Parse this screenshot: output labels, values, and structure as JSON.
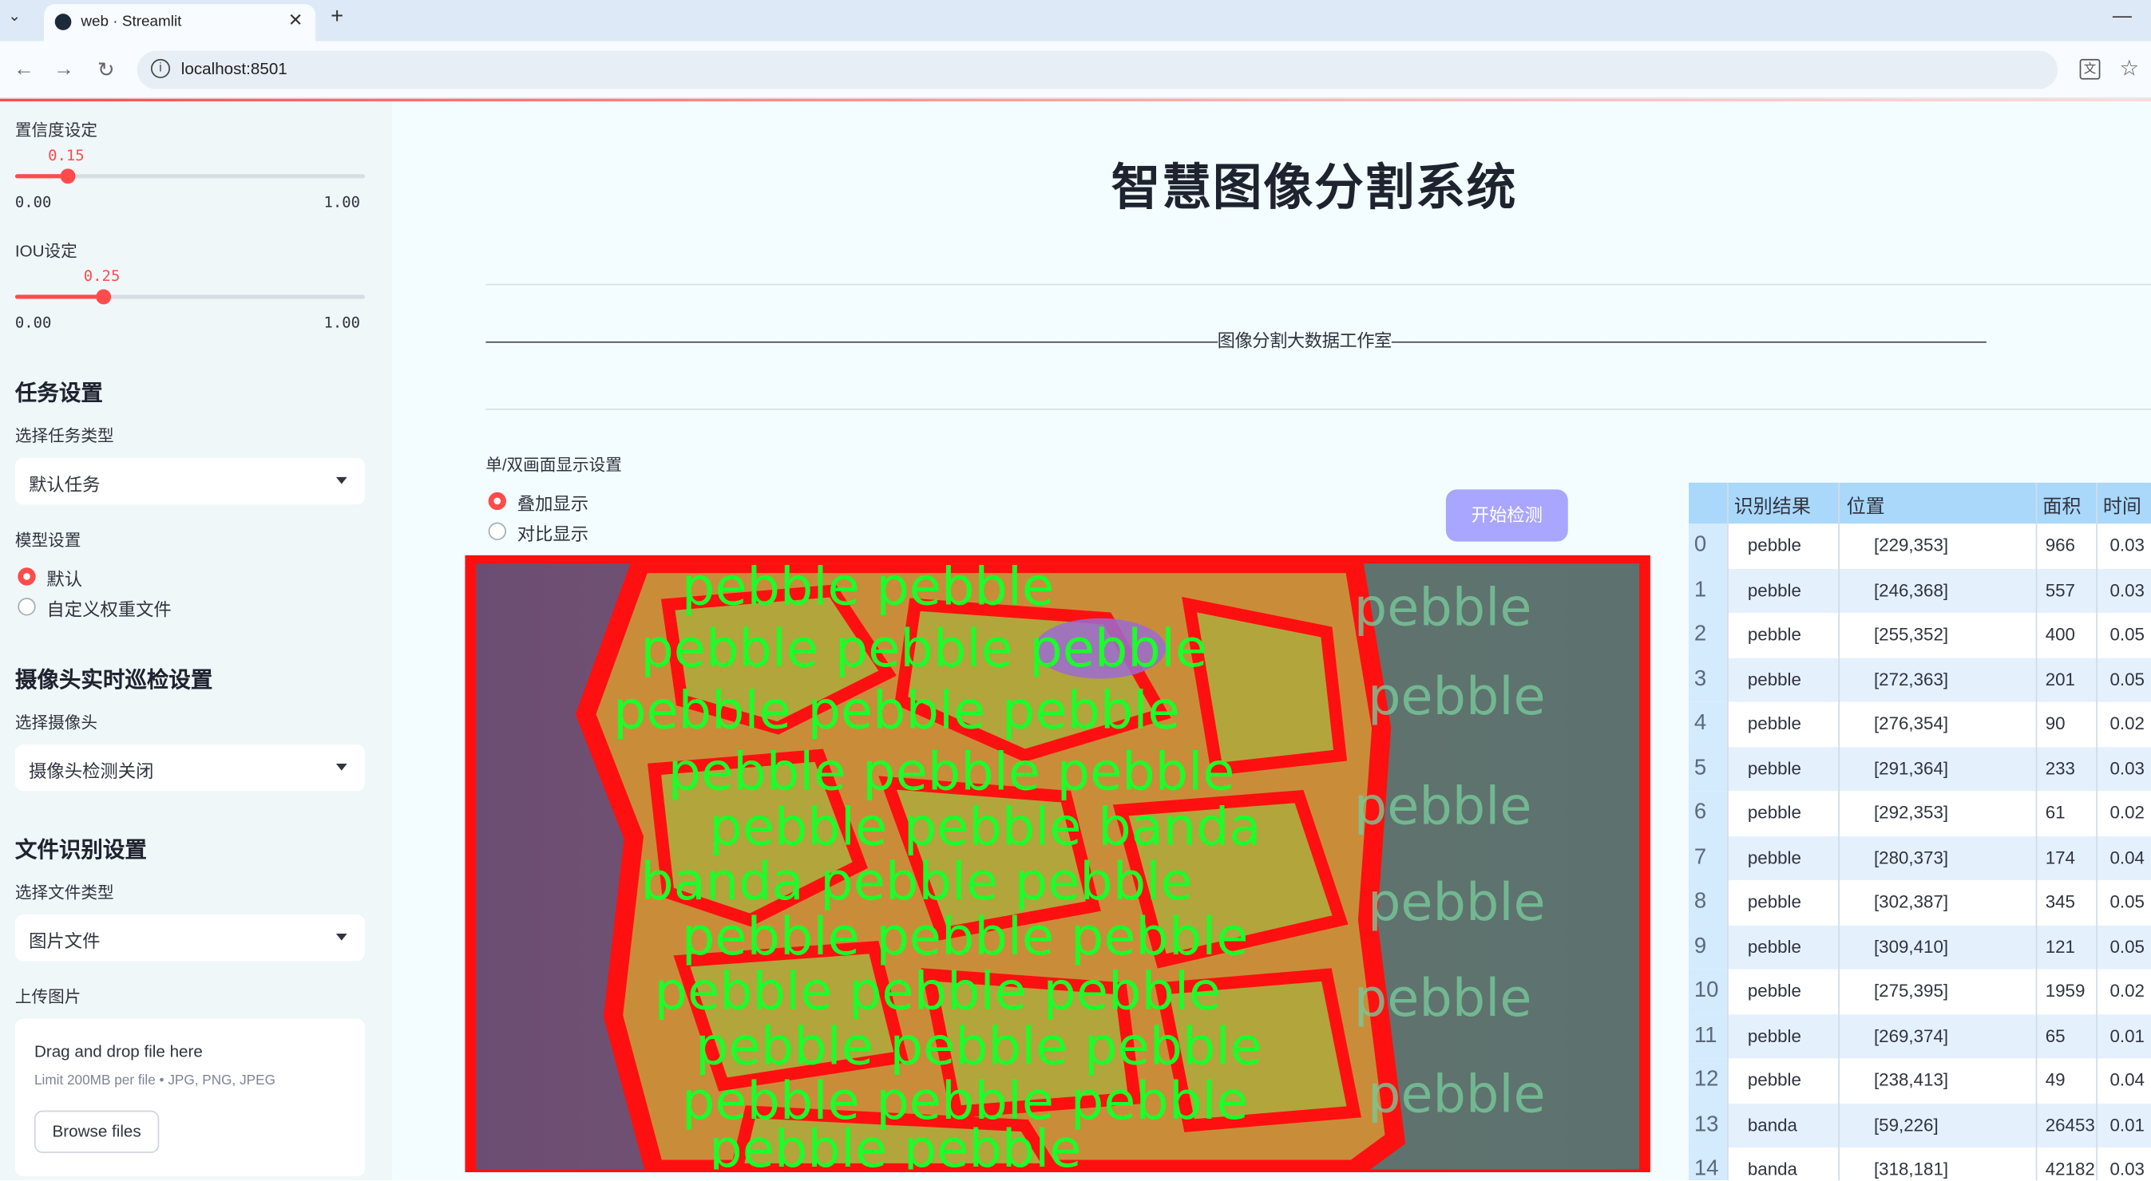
{
  "browser": {
    "tab_title": "web · Streamlit",
    "url": "localhost:8501"
  },
  "sidebar": {
    "confidence_label": "置信度设定",
    "confidence_value": "0.15",
    "confidence_min": "0.00",
    "confidence_max": "1.00",
    "confidence_fraction": 0.15,
    "iou_label": "IOU设定",
    "iou_value": "0.25",
    "iou_min": "0.00",
    "iou_max": "1.00",
    "iou_fraction": 0.25,
    "task_heading": "任务设置",
    "task_type_label": "选择任务类型",
    "task_type_value": "默认任务",
    "model_label": "模型设置",
    "model_options": [
      "默认",
      "自定义权重文件"
    ],
    "model_selected": 0,
    "camera_heading": "摄像头实时巡检设置",
    "camera_label": "选择摄像头",
    "camera_value": "摄像头检测关闭",
    "file_heading": "文件识别设置",
    "file_type_label": "选择文件类型",
    "file_type_value": "图片文件",
    "upload_label": "上传图片",
    "upload_drag_text": "Drag and drop file here",
    "upload_limit_text": "Limit 200MB per file • JPG, PNG, JPEG",
    "browse_label": "Browse files"
  },
  "main": {
    "title": "智慧图像分割系统",
    "banner": "——————————————————————————————————————————图像分割大数据工作室——————————————————————————————————————————",
    "display_label": "单/双画面显示设置",
    "display_options": [
      "叠加显示",
      "对比显示"
    ],
    "display_selected": 0,
    "start_button": "开始检测"
  },
  "table": {
    "columns": [
      "识别结果",
      "位置",
      "面积",
      "时间"
    ],
    "rows": [
      {
        "idx": "0",
        "label": "pebble",
        "pos": "[229,353]",
        "area": "966",
        "time": "0.03"
      },
      {
        "idx": "1",
        "label": "pebble",
        "pos": "[246,368]",
        "area": "557",
        "time": "0.03"
      },
      {
        "idx": "2",
        "label": "pebble",
        "pos": "[255,352]",
        "area": "400",
        "time": "0.05"
      },
      {
        "idx": "3",
        "label": "pebble",
        "pos": "[272,363]",
        "area": "201",
        "time": "0.05"
      },
      {
        "idx": "4",
        "label": "pebble",
        "pos": "[276,354]",
        "area": "90",
        "time": "0.02"
      },
      {
        "idx": "5",
        "label": "pebble",
        "pos": "[291,364]",
        "area": "233",
        "time": "0.03"
      },
      {
        "idx": "6",
        "label": "pebble",
        "pos": "[292,353]",
        "area": "61",
        "time": "0.02"
      },
      {
        "idx": "7",
        "label": "pebble",
        "pos": "[280,373]",
        "area": "174",
        "time": "0.04"
      },
      {
        "idx": "8",
        "label": "pebble",
        "pos": "[302,387]",
        "area": "345",
        "time": "0.05"
      },
      {
        "idx": "9",
        "label": "pebble",
        "pos": "[309,410]",
        "area": "121",
        "time": "0.05"
      },
      {
        "idx": "10",
        "label": "pebble",
        "pos": "[275,395]",
        "area": "1959",
        "time": "0.02"
      },
      {
        "idx": "11",
        "label": "pebble",
        "pos": "[269,374]",
        "area": "65",
        "time": "0.01"
      },
      {
        "idx": "12",
        "label": "pebble",
        "pos": "[238,413]",
        "area": "49",
        "time": "0.04"
      },
      {
        "idx": "13",
        "label": "banda",
        "pos": "[59,226]",
        "area": "26453",
        "time": "0.01"
      },
      {
        "idx": "14",
        "label": "banda",
        "pos": "[318,181]",
        "area": "42182",
        "time": "0.03"
      }
    ]
  },
  "colors": {
    "accent": "#ff4b4b",
    "button": "#a9a6ff",
    "table_header": "#a9d8fb",
    "mask_outline": "#ff1010",
    "mask_text": "#1aff2a"
  }
}
